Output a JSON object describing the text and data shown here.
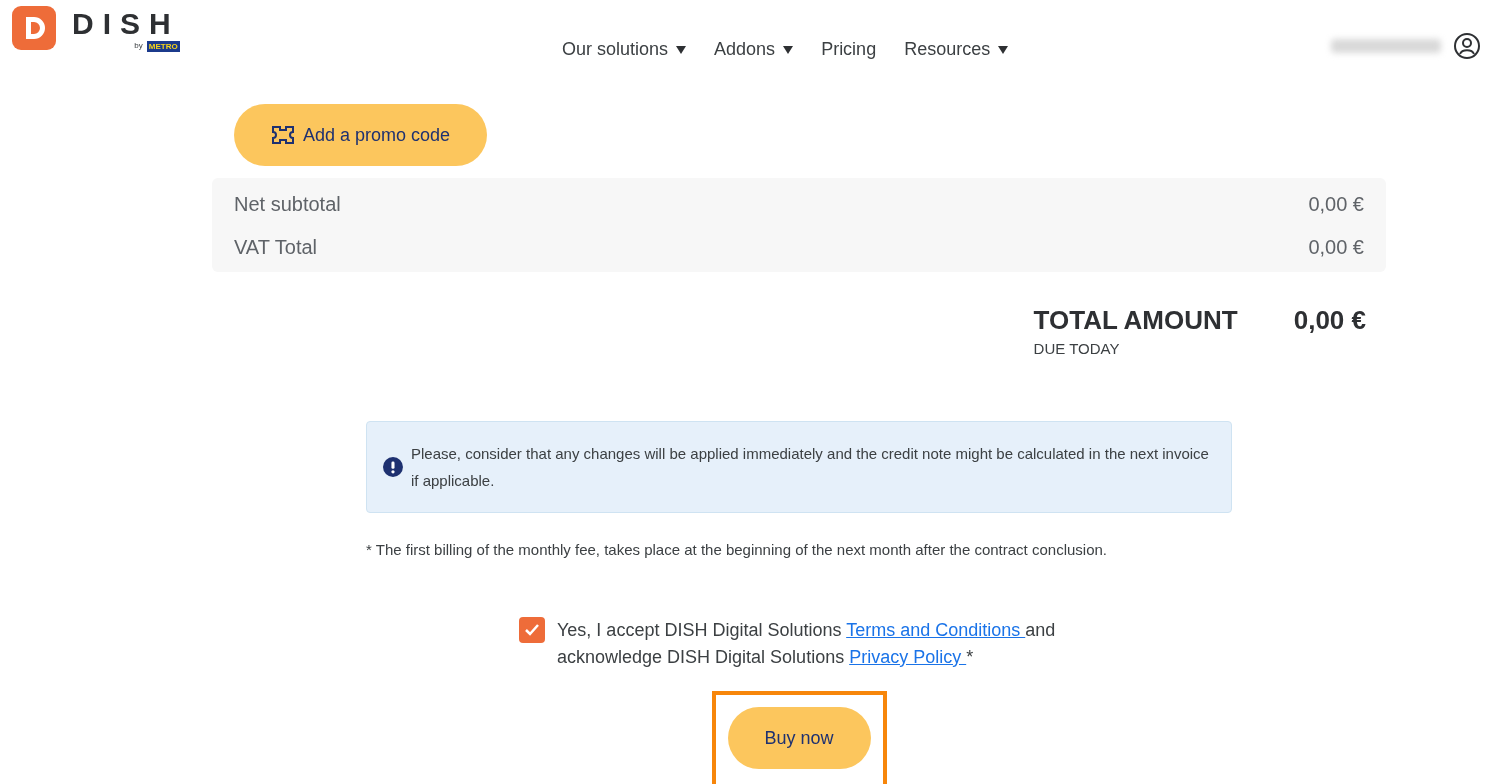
{
  "logo": {
    "name": "DISH",
    "by": "by",
    "partner": "METRO"
  },
  "nav": [
    {
      "label": "Our solutions",
      "dropdown": true
    },
    {
      "label": "Addons",
      "dropdown": true
    },
    {
      "label": "Pricing",
      "dropdown": false
    },
    {
      "label": "Resources",
      "dropdown": true
    }
  ],
  "promo_button": "Add a promo code",
  "summary": [
    {
      "label": "Net subtotal",
      "value": "0,00 €"
    },
    {
      "label": "VAT Total",
      "value": "0,00 €"
    }
  ],
  "total": {
    "label": "TOTAL AMOUNT",
    "sublabel": "DUE TODAY",
    "value": "0,00 €"
  },
  "notice": "Please, consider that any changes will be applied immediately and the credit note might be calculated in the next invoice if applicable.",
  "footnote": "* The first billing of the monthly fee, takes place at the beginning of the next month after the contract conclusion.",
  "consent": {
    "checked": true,
    "text_1": "Yes, I accept DISH Digital Solutions ",
    "link_1": "Terms and Conditions ",
    "text_2": "and acknowledge DISH Digital Solutions ",
    "link_2": "Privacy Policy ",
    "text_3": "*"
  },
  "buy_button": {
    "label": "Buy now",
    "highlighted": true
  }
}
